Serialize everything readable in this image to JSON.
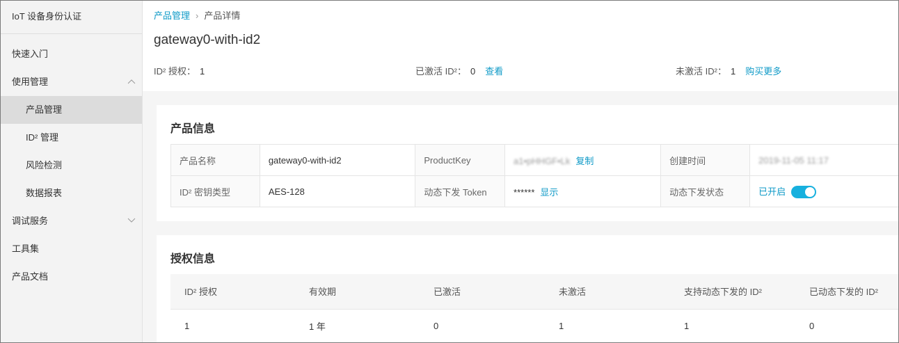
{
  "sidebar": {
    "title": "IoT 设备身份认证",
    "items": [
      {
        "label": "快速入门"
      },
      {
        "label": "使用管理"
      },
      {
        "label": "产品管理"
      },
      {
        "label": "ID² 管理"
      },
      {
        "label": "风险检测"
      },
      {
        "label": "数据报表"
      },
      {
        "label": "调试服务"
      },
      {
        "label": "工具集"
      },
      {
        "label": "产品文档"
      }
    ]
  },
  "breadcrumb": {
    "parent": "产品管理",
    "separator": "›",
    "current": "产品详情"
  },
  "page": {
    "title": "gateway0-with-id2"
  },
  "stats": {
    "authorized_label": "ID² 授权：",
    "authorized_value": "1",
    "activated_label": "已激活 ID²：",
    "activated_value": "0",
    "activated_action": "查看",
    "inactive_label": "未激活 ID²：",
    "inactive_value": "1",
    "inactive_action": "购买更多"
  },
  "product_info": {
    "title": "产品信息",
    "name_label": "产品名称",
    "name_value": "gateway0-with-id2",
    "productkey_label": "ProductKey",
    "productkey_value": "a1•pHHGF•Lk",
    "copy_label": "复制",
    "created_label": "创建时间",
    "created_value": "2019-11-05 11:17",
    "key_type_label": "ID² 密钥类型",
    "key_type_value": "AES-128",
    "token_label": "动态下发 Token",
    "token_value": "******",
    "show_label": "显示",
    "dyn_status_label": "动态下发状态",
    "dyn_status_value": "已开启",
    "dyn_status_on": true
  },
  "grant_info": {
    "title": "授权信息",
    "columns": [
      "ID² 授权",
      "有效期",
      "已激活",
      "未激活",
      "支持动态下发的 ID²",
      "已动态下发的 ID²"
    ],
    "rows": [
      [
        "1",
        "1 年",
        "0",
        "1",
        "1",
        "0"
      ]
    ]
  },
  "colors": {
    "link": "#0f9ac7",
    "toggle_on": "#17b0de",
    "sidebar_bg": "#f3f3f3",
    "sidebar_active": "#dcdcdc"
  }
}
